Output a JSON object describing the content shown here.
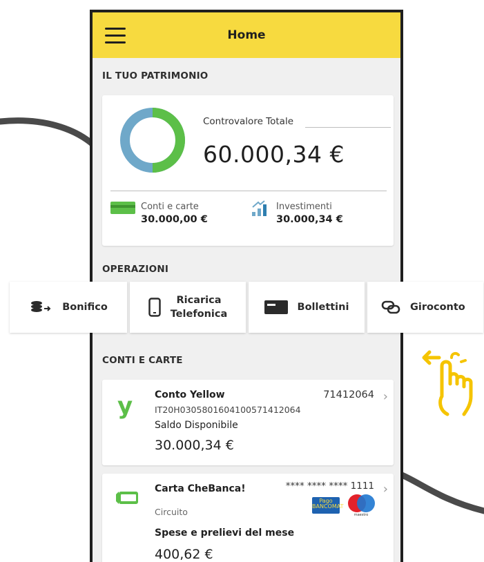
{
  "header": {
    "title": "Home"
  },
  "patrimonio": {
    "section_title": "IL TUO PATRIMONIO",
    "total_label": "Controvalore Totale",
    "total_value": "60.000,34 €",
    "conti_label": "Conti e carte",
    "conti_value": "30.000,00 €",
    "investimenti_label": "Investimenti",
    "investimenti_value": "30.000,34 €",
    "donut": {
      "conti_share": 0.5,
      "investimenti_share": 0.5,
      "colors": {
        "conti": "#5cbf48",
        "investimenti": "#6fa8c9"
      }
    }
  },
  "operazioni": {
    "section_title": "OPERAZIONI",
    "items": [
      {
        "label": "Bonifico",
        "icon": "coins-transfer-icon"
      },
      {
        "label_line1": "Ricarica",
        "label_line2": "Telefonica",
        "icon": "smartphone-icon"
      },
      {
        "label": "Bollettini",
        "icon": "bill-icon"
      },
      {
        "label": "Giroconto",
        "icon": "link-icon"
      }
    ]
  },
  "conti_carte": {
    "section_title": "CONTI E CARTE",
    "conto": {
      "name": "Conto Yellow",
      "number": "71412064",
      "iban": "IT20H0305801604100571412064",
      "balance_label": "Saldo Disponibile",
      "balance": "30.000,34 €"
    },
    "carta": {
      "name": "Carta CheBanca!",
      "number": "**** **** **** 1111",
      "circuit_label": "Circuito",
      "spending_label": "Spese e prelievi del mese",
      "spending": "400,62 €",
      "logo_pagobancomat": "Pago BANCOMAT",
      "logo_maestro": "maestro"
    }
  },
  "colors": {
    "accent_yellow": "#f7da3f",
    "green": "#5cbf48",
    "blue": "#6fa8c9"
  }
}
